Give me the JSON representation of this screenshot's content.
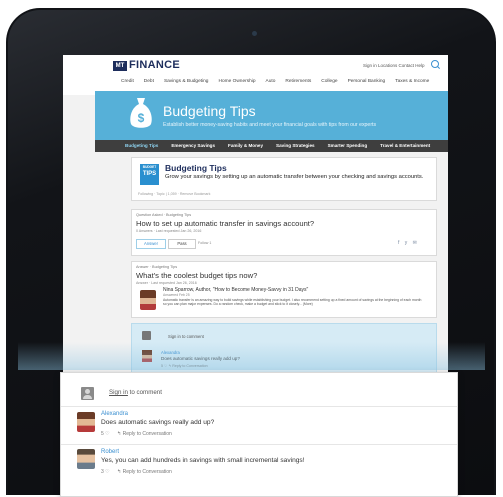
{
  "site": {
    "logo_box": "MT",
    "logo_text": "FINANCE",
    "top_links": "Sign in   Locations   Contact   Help",
    "main_nav": [
      "Credit",
      "Debt",
      "Savings & Budgeting",
      "Home Ownership",
      "Auto",
      "Retirements",
      "College",
      "Personal Banking",
      "Taxes & Income"
    ]
  },
  "banner": {
    "title": "Budgeting Tips",
    "subtitle": "Establish better money-saving habits and meet your financial goals with tips from our experts"
  },
  "subnav": [
    "Budgeting Tips",
    "Emergency Savings",
    "Family & Money",
    "Saving Strategies",
    "Smarter Spending",
    "Travel & Entertainment"
  ],
  "tips_card": {
    "icon_top": "BUDGET",
    "icon_bottom": "TIPS",
    "title": "Budgeting Tips",
    "text": "Grow your savings by setting up an automatic transfer between your checking and savings accounts.",
    "meta": "Following · Topic | 1,059 · Remove Bookmark"
  },
  "question_card": {
    "label": "Question Asked · Budgeting Tips",
    "title": "How to set up automatic transfer in savings account?",
    "meta": "0 Answers · Last requested Jan 26, 2016",
    "answer_btn": "Answer",
    "pass_btn": "Pass",
    "follow": "Follow 1",
    "share_icons": "f y ✉"
  },
  "answer_card": {
    "label": "Answer · Budgeting Tips",
    "title": "What's the coolest budget tips now?",
    "meta": "Answer · Last requested Jan 26, 2016",
    "author": "Nina Sparrow, Author, \"How to Become Money-Savvy in 31 Days\"",
    "date": "Answered Feb 25",
    "text": "Automatic transfer is an amazing way to build savings while establishing your budget. I also recommend setting up a fixed amount of savings at the beginning of each month so you can plan major expenses. Do a random check, make a budget and stick to it closely... (More)"
  },
  "comment_card": {
    "signin": "Sign in to comment",
    "name": "Alexandra",
    "text": "Does automatic savings really add up?",
    "meta": "5 ♡   ↰ Reply to Conversation"
  },
  "zoom": {
    "signin_link": "Sign in",
    "signin_rest": " to comment",
    "comments": [
      {
        "name": "Alexandra",
        "text": "Does automatic savings really add up?",
        "likes": "5",
        "reply": "Reply to Conversation"
      },
      {
        "name": "Robert",
        "text": "Yes, you can add hundreds in savings with small incremental savings!",
        "likes": "3",
        "reply": "Reply to Conversation"
      }
    ]
  }
}
